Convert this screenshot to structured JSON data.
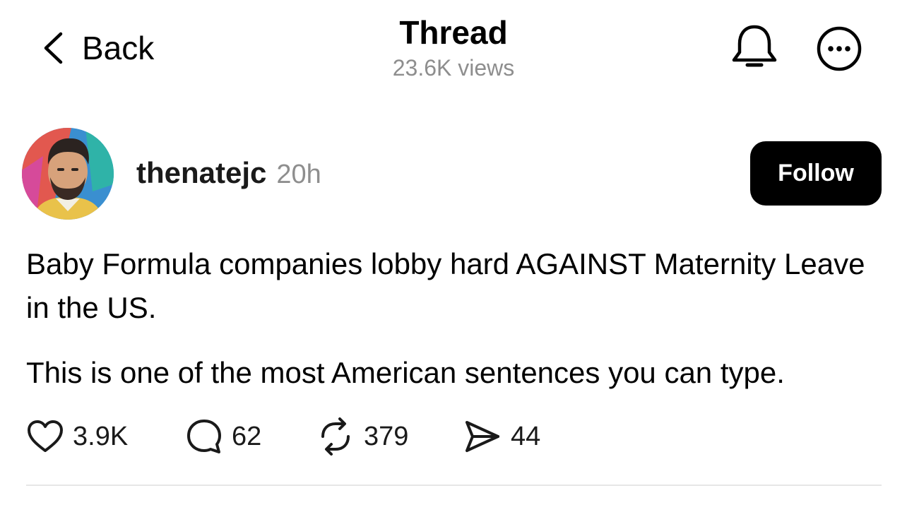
{
  "header": {
    "back_label": "Back",
    "title": "Thread",
    "views": "23.6K views"
  },
  "icons": {
    "back": "chevron-left-icon",
    "notifications": "bell-icon",
    "more": "more-options-icon",
    "like": "heart-icon",
    "reply": "comment-bubble-icon",
    "repost": "repost-icon",
    "share": "send-icon"
  },
  "post": {
    "author": {
      "username": "thenatejc",
      "time": "20h"
    },
    "follow_label": "Follow",
    "paragraphs": [
      "Baby Formula companies lobby hard AGAINST Maternity Leave in the US.",
      "This is one of the most American sentences you can type."
    ],
    "stats": {
      "likes": "3.9K",
      "replies": "62",
      "reposts": "379",
      "shares": "44"
    }
  },
  "colors": {
    "text": "#000000",
    "muted": "#8e8e8e",
    "follow_bg": "#000000",
    "follow_text": "#ffffff",
    "divider": "#e6e6e6"
  }
}
